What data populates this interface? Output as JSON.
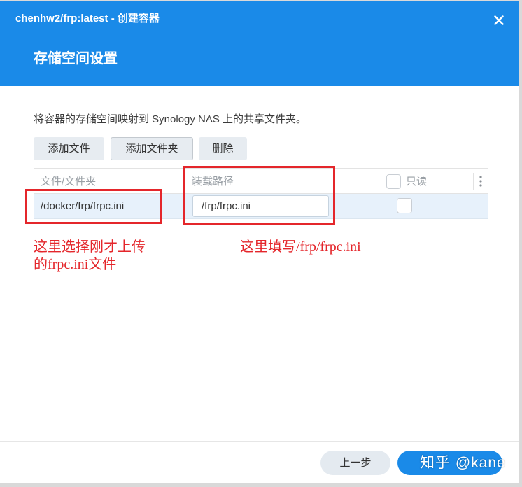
{
  "dialog": {
    "title": "chenhw2/frp:latest - 创建容器",
    "close_icon": "close-icon",
    "heading": "存储空间设置"
  },
  "content": {
    "description": "将容器的存储空间映射到 Synology NAS 上的共享文件夹。",
    "toolbar": {
      "add_file": "添加文件",
      "add_folder": "添加文件夹",
      "delete": "删除"
    },
    "table": {
      "columns": [
        "文件/文件夹",
        "装载路径",
        "只读"
      ],
      "more_icon": "more-vertical-icon",
      "rows": [
        {
          "file": "/docker/frp/frpc.ini",
          "mount_path": "/frp/frpc.ini",
          "readonly": false
        }
      ]
    }
  },
  "annotations": {
    "left_note": [
      "这里选择刚才上传",
      "的frpc.ini文件"
    ],
    "right_note": "这里填写/frp/frpc.ini",
    "color": "#e4262b"
  },
  "footer": {
    "back": "上一步"
  },
  "watermark": "知乎 @kane",
  "colors": {
    "accent": "#1a8ae8",
    "row_selected": "#e7f1fb"
  }
}
